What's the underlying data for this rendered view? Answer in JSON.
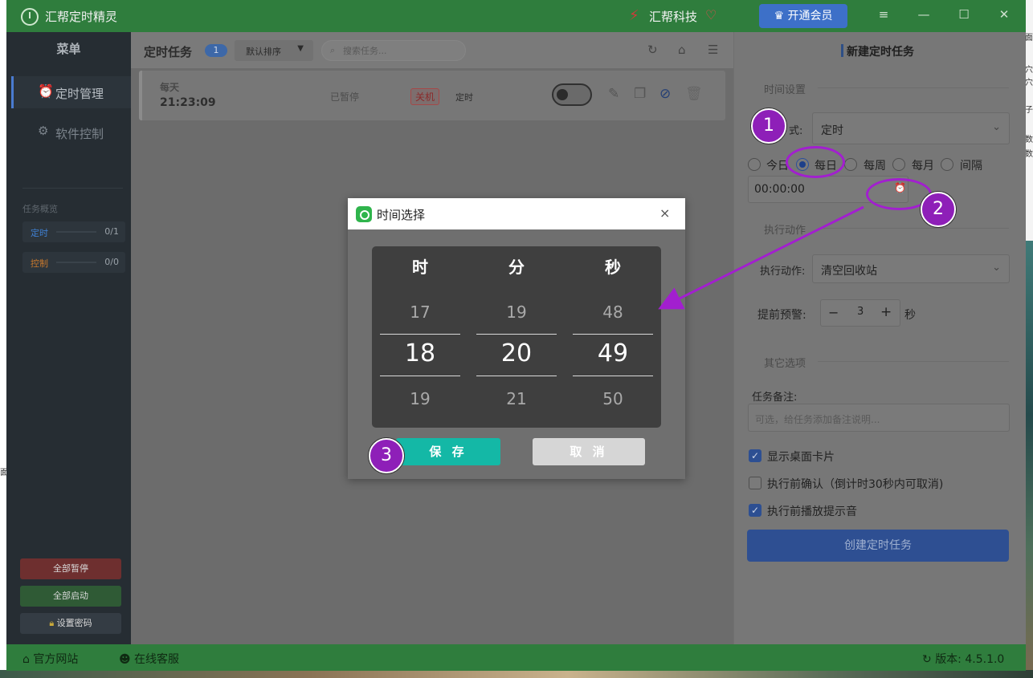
{
  "app": {
    "title": "汇帮定时精灵",
    "brand": "汇帮科技",
    "vip_label": "开通会员"
  },
  "sidebar": {
    "menu_title": "菜单",
    "nav": [
      {
        "label": "定时管理",
        "icon": "alarm-clock-icon"
      },
      {
        "label": "软件控制",
        "icon": "gear-icon"
      }
    ],
    "overview_title": "任务概览",
    "overview": [
      {
        "label": "定时",
        "count": "0/1",
        "color": "#3f7fd1"
      },
      {
        "label": "控制",
        "count": "0/0",
        "color": "#c7782d"
      }
    ],
    "buttons": {
      "pause_all": "全部暂停",
      "start_all": "全部启动",
      "set_password": "设置密码"
    }
  },
  "main": {
    "title": "定时任务",
    "count": "1",
    "sort_label": "默认排序",
    "search_placeholder": "搜索任务...",
    "task": {
      "frequency": "每天",
      "time": "21:23:09",
      "status": "已暂停",
      "action": "关机",
      "type": "定时"
    }
  },
  "right_panel": {
    "title": "新建定时任务",
    "time_section": "时间设置",
    "mode_label": "式:",
    "mode_value": "定时",
    "radios": [
      {
        "label": "今日",
        "checked": false
      },
      {
        "label": "每日",
        "checked": true
      },
      {
        "label": "每周",
        "checked": false
      },
      {
        "label": "每月",
        "checked": false
      },
      {
        "label": "间隔",
        "checked": false
      }
    ],
    "time_value": "00:00:00",
    "action_section": "执行动作",
    "action_label": "执行动作:",
    "action_value": "清空回收站",
    "warn_label": "提前预警:",
    "warn_minus": "−",
    "warn_value": "3",
    "warn_plus": "+",
    "warn_unit": "秒",
    "other_section": "其它选项",
    "note_label": "任务备注:",
    "note_placeholder": "可选，给任务添加备注说明...",
    "checks": [
      {
        "label": "显示桌面卡片",
        "checked": true
      },
      {
        "label": "执行前确认（倒计时30秒内可取消)",
        "checked": false
      },
      {
        "label": "执行前播放提示音",
        "checked": true
      }
    ],
    "create_label": "创建定时任务"
  },
  "statusbar": {
    "website": "官方网站",
    "support": "在线客服",
    "version": "版本: 4.5.1.0"
  },
  "dialog": {
    "title": "时间选择",
    "close": "×",
    "columns": [
      {
        "head": "时",
        "prev": "17",
        "sel": "18",
        "next": "19"
      },
      {
        "head": "分",
        "prev": "19",
        "sel": "20",
        "next": "21"
      },
      {
        "head": "秒",
        "prev": "48",
        "sel": "49",
        "next": "50"
      }
    ],
    "save_label": "保 存",
    "cancel_label": "取 消"
  },
  "annotations": {
    "badges": [
      "1",
      "2",
      "3"
    ],
    "color": "#8e1fb8"
  }
}
